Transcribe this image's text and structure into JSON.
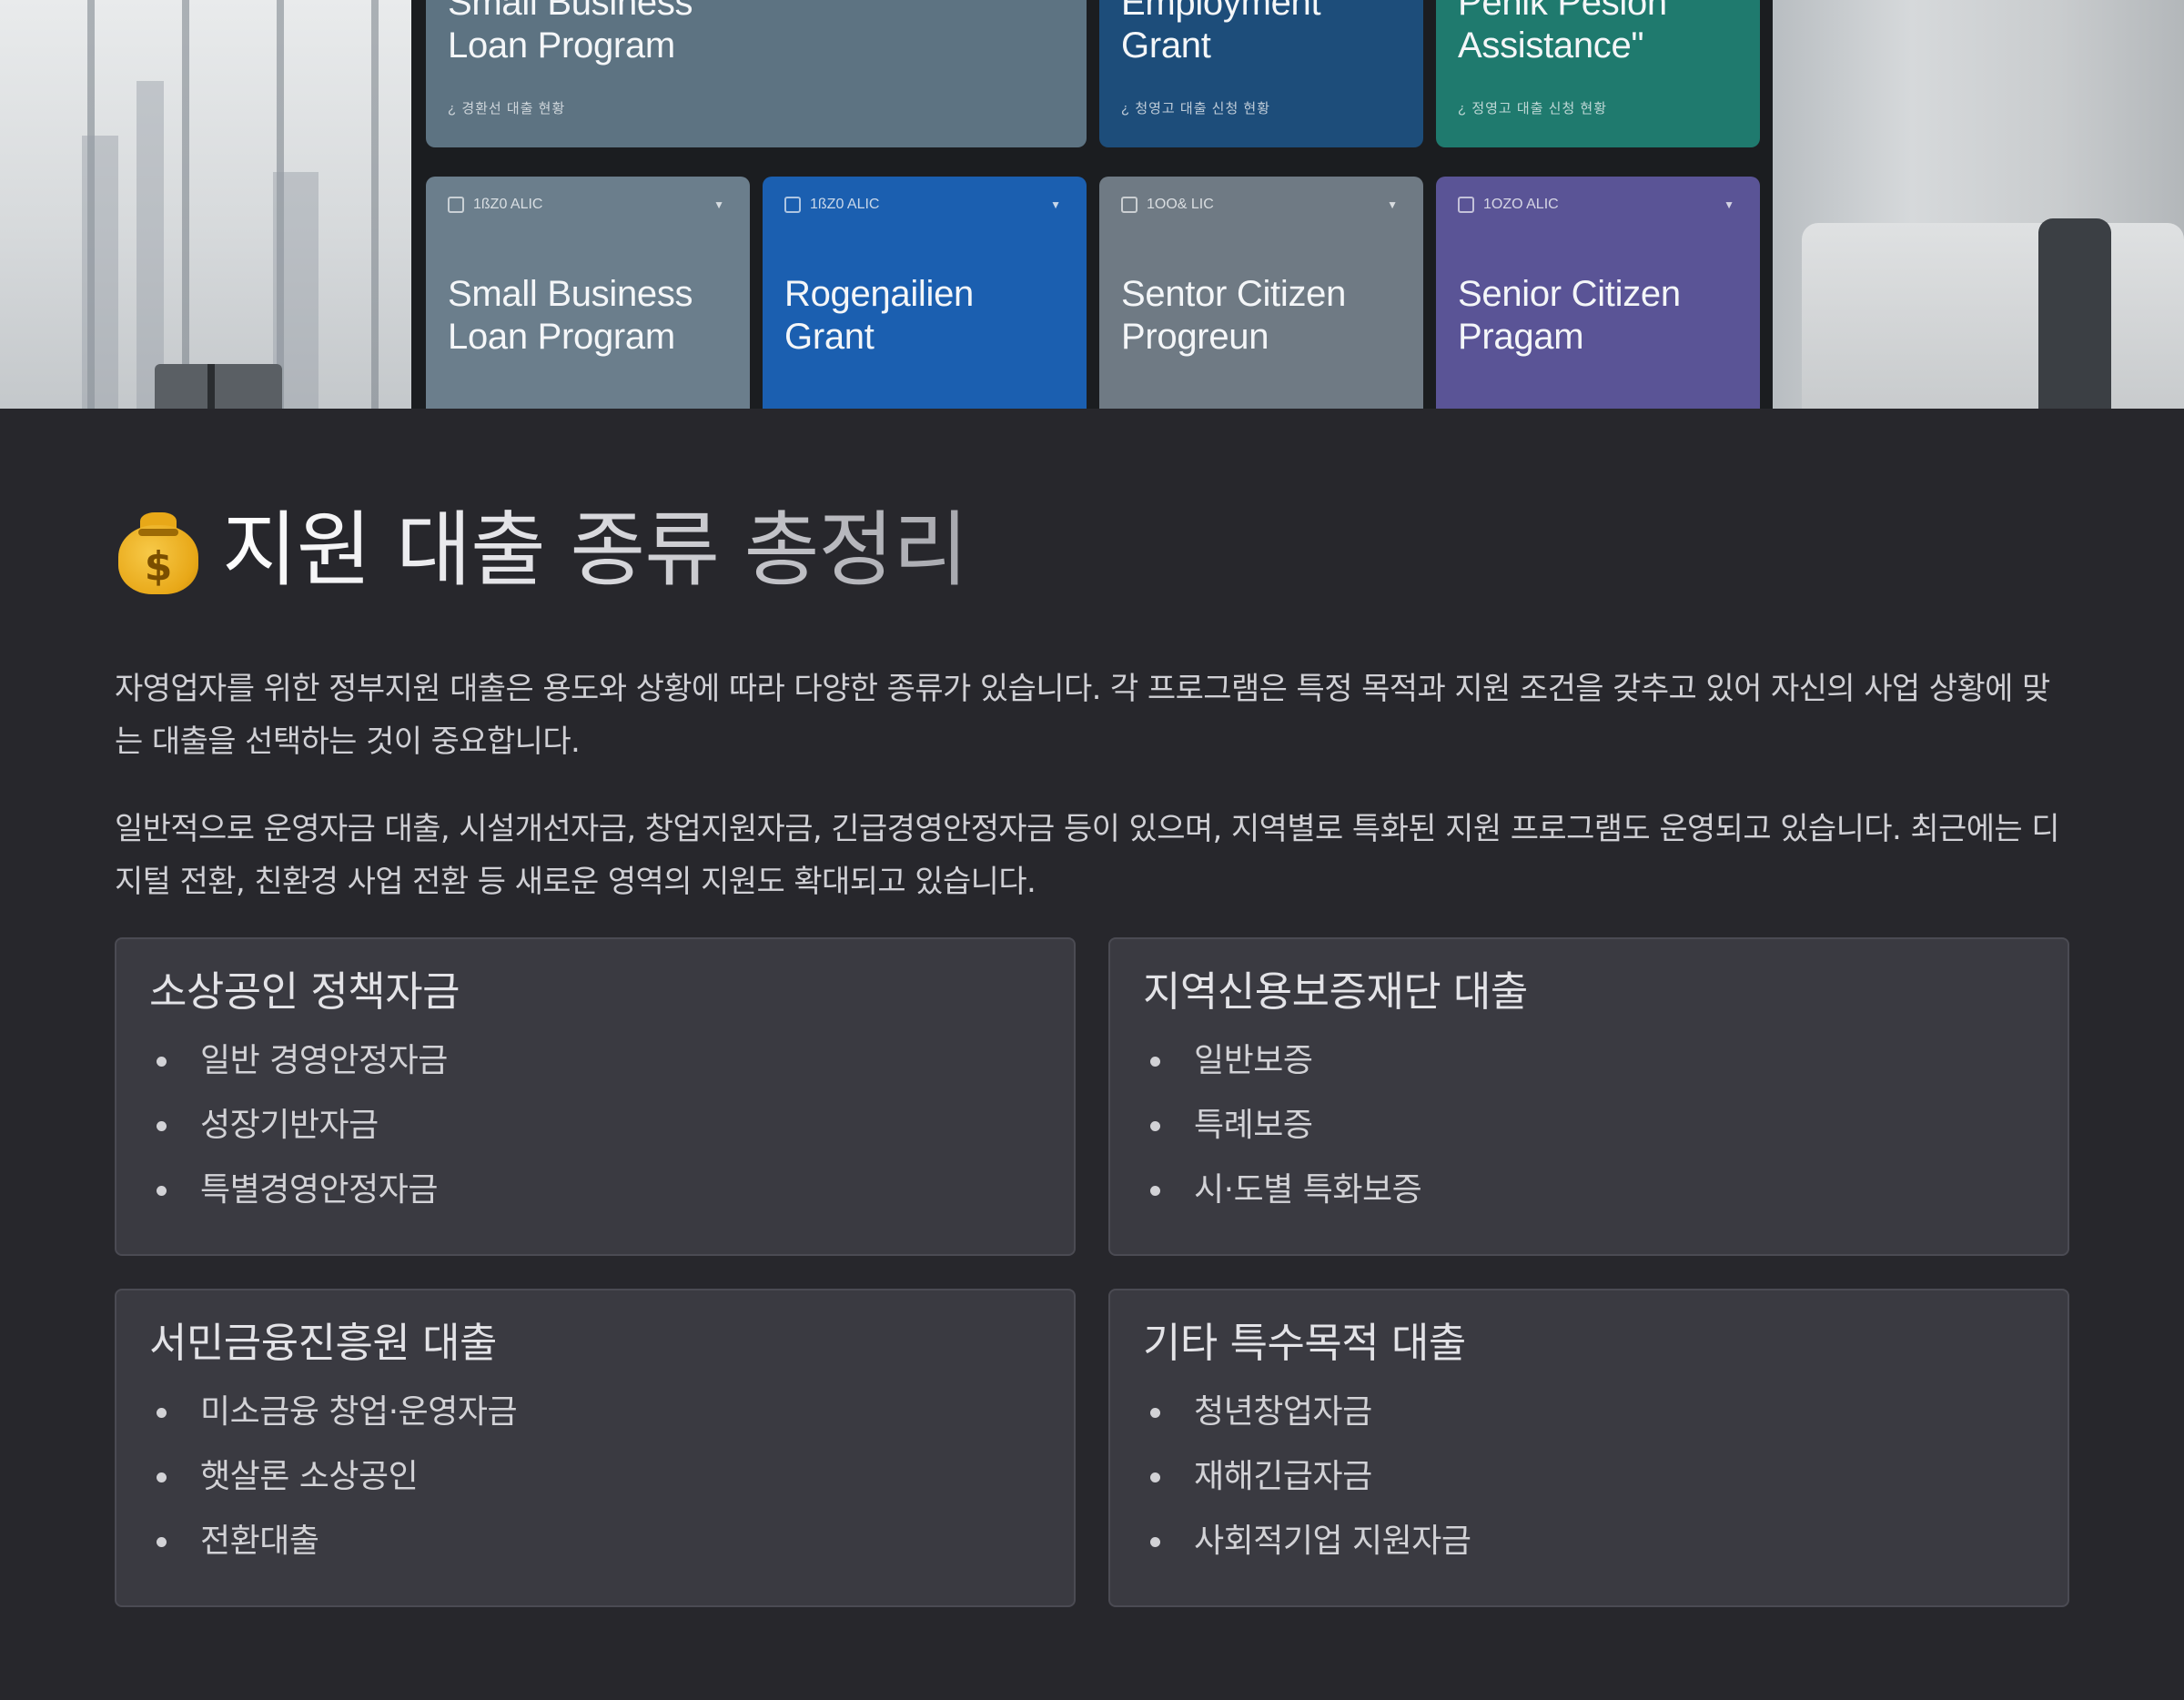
{
  "hero": {
    "tiles_top": [
      {
        "title": "Small Business\nLoan Program",
        "meta": "¿ 경환선 대출 현황",
        "color": "#5d7382"
      },
      {
        "title": "Employment\nGrant",
        "meta": "¿ 청영고 대출 신청 현황",
        "color": "#1d4d7a"
      },
      {
        "title": "Penik Pesion\nAssistance\"",
        "meta": "¿ 정영고 대출 신청 현황",
        "color": "#1f7a6e"
      }
    ],
    "tiles_bottom": [
      {
        "title": "Small Business\nLoan Program",
        "tag": "1ßZ0 ALIC",
        "color": "#6b7e8c"
      },
      {
        "title": "Rogeŋailien\nGrant",
        "tag": "1ßZ0 ALIC",
        "color": "#1b5fb0"
      },
      {
        "title": "Sentor Citizen\nProgreun",
        "tag": "1OO& LIC",
        "color": "#6f7a84"
      },
      {
        "title": "Senior Citizen\nPragam",
        "tag": "1OZO ALIC",
        "color": "#5a5496"
      }
    ]
  },
  "page": {
    "title": "지원 대출 종류 총정리",
    "title_icon": "money-bag-icon",
    "paragraph_1": "자영업자를 위한 정부지원 대출은 용도와 상황에 따라 다양한 종류가 있습니다. 각 프로그램은 특정 목적과 지원 조건을 갖추고 있어 자신의 사업 상황에 맞는 대출을 선택하는 것이 중요합니다.",
    "paragraph_2": "일반적으로 운영자금 대출, 시설개선자금, 창업지원자금, 긴급경영안정자금 등이 있으며, 지역별로 특화된 지원 프로그램도 운영되고 있습니다. 최근에는 디지털 전환, 친환경 사업 전환 등 새로운 영역의 지원도 확대되고 있습니다."
  },
  "cards": [
    {
      "title": "소상공인 정책자금",
      "items": [
        "일반 경영안정자금",
        "성장기반자금",
        "특별경영안정자금"
      ]
    },
    {
      "title": "지역신용보증재단 대출",
      "items": [
        "일반보증",
        "특례보증",
        "시·도별 특화보증"
      ]
    },
    {
      "title": "서민금융진흥원 대출",
      "items": [
        "미소금융 창업·운영자금",
        "햇살론 소상공인",
        "전환대출"
      ]
    },
    {
      "title": "기타 특수목적 대출",
      "items": [
        "청년창업자금",
        "재해긴급자금",
        "사회적기업 지원자금"
      ]
    }
  ]
}
